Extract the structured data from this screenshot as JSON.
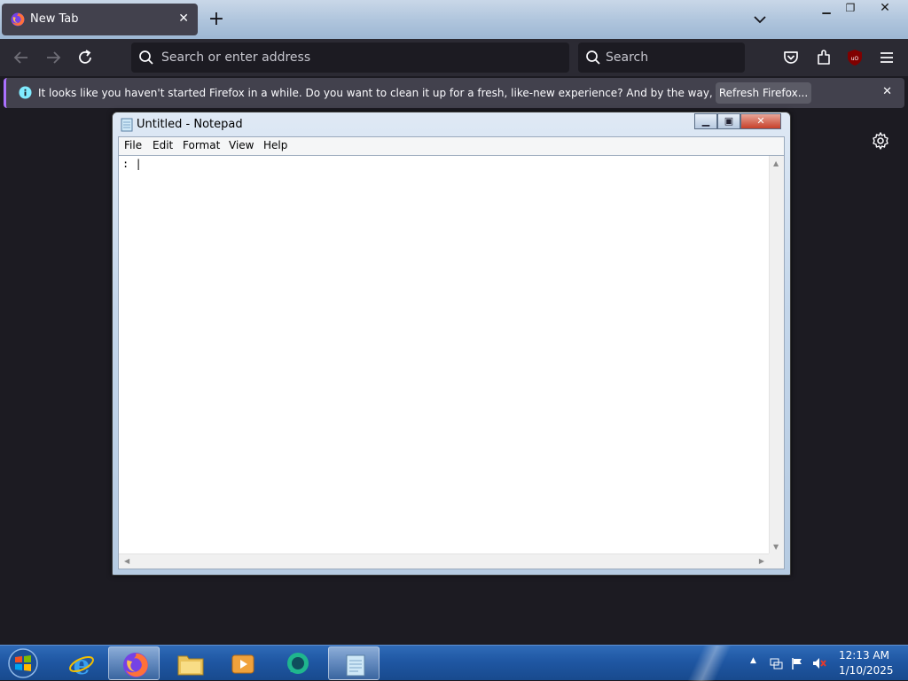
{
  "browser": {
    "tab_title": "New Tab",
    "address_placeholder": "Search or enter address",
    "search_placeholder": "Search",
    "infobar_message": "It looks like you haven't started Firefox in a while. Do you want to clean it up for a fresh, like-new experience? And by the way, welcome back!",
    "infobar_button": "Refresh Firefox...",
    "accent_color": "#ab71ff"
  },
  "notepad": {
    "title": "Untitled - Notepad",
    "menu": [
      "File",
      "Edit",
      "Format",
      "View",
      "Help"
    ],
    "content": ": |"
  },
  "taskbar": {
    "apps": [
      "internet-explorer",
      "firefox",
      "file-explorer",
      "media-player",
      "chat-app",
      "notepad"
    ],
    "time": "12:13 AM",
    "date": "1/10/2025"
  }
}
